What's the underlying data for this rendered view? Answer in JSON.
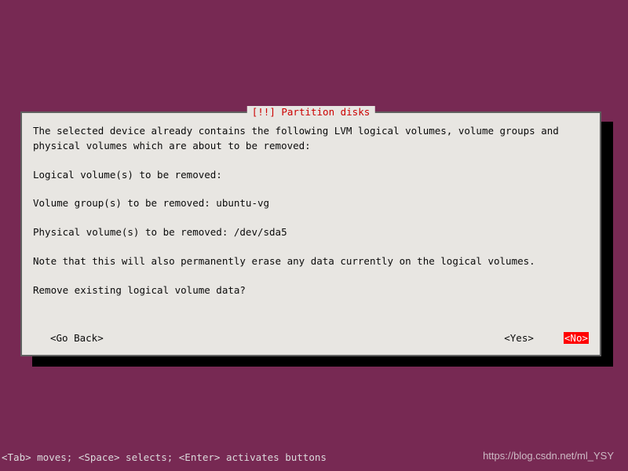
{
  "dialog": {
    "title": "[!!] Partition disks",
    "intro": "The selected device already contains the following LVM logical volumes, volume groups and physical volumes which are about to be removed:",
    "lv_line": "Logical volume(s) to be removed:",
    "vg_line": "Volume group(s) to be removed: ubuntu-vg",
    "pv_line": "Physical volume(s) to be removed: /dev/sda5",
    "note": "Note that this will also permanently erase any data currently on the logical volumes.",
    "question": "Remove existing logical volume data?",
    "go_back": "<Go Back>",
    "yes": "<Yes>",
    "no": "<No>"
  },
  "help_bar": "<Tab> moves; <Space> selects; <Enter> activates buttons",
  "watermark": "https://blog.csdn.net/ml_YSY"
}
